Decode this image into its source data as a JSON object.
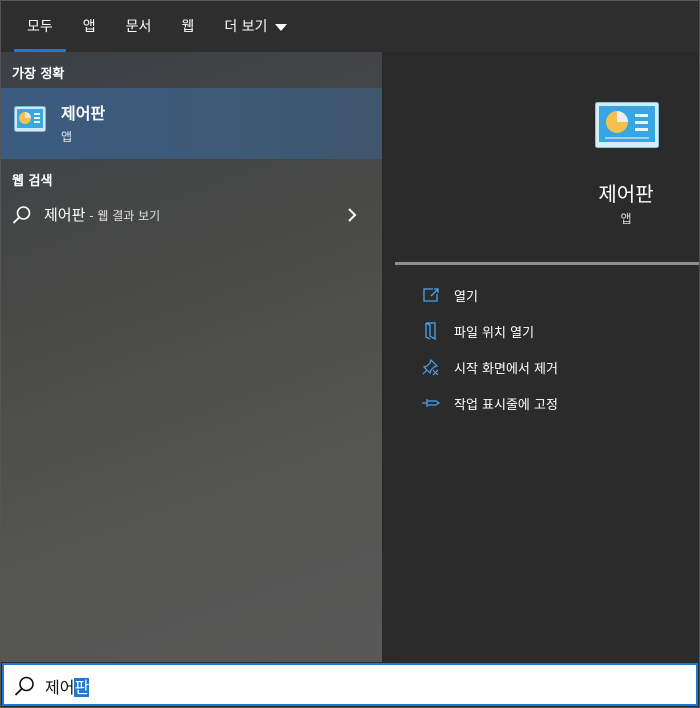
{
  "tabs": [
    {
      "label": "모두",
      "active": true
    },
    {
      "label": "앱"
    },
    {
      "label": "문서"
    },
    {
      "label": "웹"
    },
    {
      "label": "더 보기"
    }
  ],
  "best_match": {
    "section_label": "가장 정확",
    "title": "제어판",
    "subtitle": "앱"
  },
  "web_search": {
    "section_label": "웹 검색",
    "query": "제어판",
    "suffix": " - 웹 결과 보기"
  },
  "detail": {
    "title": "제어판",
    "subtitle": "앱",
    "actions": [
      {
        "label": "열기",
        "icon": "open-icon"
      },
      {
        "label": "파일 위치 열기",
        "icon": "file-location-icon"
      },
      {
        "label": "시작 화면에서 제거",
        "icon": "unpin-icon"
      },
      {
        "label": "작업 표시줄에 고정",
        "icon": "pin-icon"
      }
    ]
  },
  "search": {
    "typed": "제어",
    "selected": "판"
  },
  "colors": {
    "accent": "#1e78d4",
    "selected_row": "#3d5a76"
  }
}
